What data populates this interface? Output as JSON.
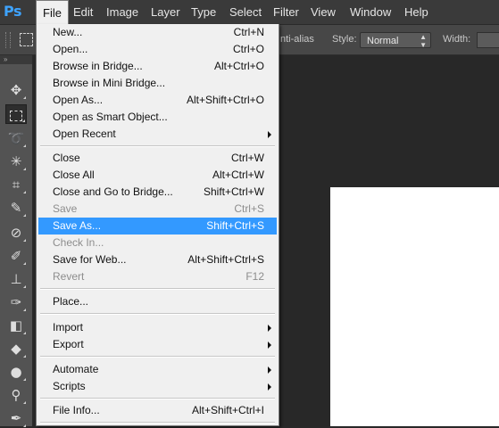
{
  "app": {
    "logo": "Ps"
  },
  "menubar": {
    "items": [
      "File",
      "Edit",
      "Image",
      "Layer",
      "Type",
      "Select",
      "Filter",
      "View",
      "Window",
      "Help"
    ],
    "active": "File"
  },
  "options": {
    "antialias_label": "nti-alias",
    "style_label": "Style:",
    "style_value": "Normal",
    "width_label": "Width:"
  },
  "tools": [
    "move-tool-icon",
    "rectangular-marquee-tool-icon",
    "lasso-tool-icon",
    "magic-wand-tool-icon",
    "crop-tool-icon",
    "eyedropper-tool-icon",
    "spot-healing-brush-tool-icon",
    "brush-tool-icon",
    "clone-stamp-tool-icon",
    "history-brush-tool-icon",
    "eraser-tool-icon",
    "paint-bucket-tool-icon",
    "blur-tool-icon",
    "dodge-tool-icon",
    "pen-tool-icon"
  ],
  "file_menu": {
    "groups": [
      [
        {
          "label": "New...",
          "shortcut": "Ctrl+N"
        },
        {
          "label": "Open...",
          "shortcut": "Ctrl+O"
        },
        {
          "label": "Browse in Bridge...",
          "shortcut": "Alt+Ctrl+O"
        },
        {
          "label": "Browse in Mini Bridge...",
          "shortcut": ""
        },
        {
          "label": "Open As...",
          "shortcut": "Alt+Shift+Ctrl+O"
        },
        {
          "label": "Open as Smart Object...",
          "shortcut": ""
        },
        {
          "label": "Open Recent",
          "shortcut": "",
          "submenu": true
        }
      ],
      [
        {
          "label": "Close",
          "shortcut": "Ctrl+W"
        },
        {
          "label": "Close All",
          "shortcut": "Alt+Ctrl+W"
        },
        {
          "label": "Close and Go to Bridge...",
          "shortcut": "Shift+Ctrl+W"
        },
        {
          "label": "Save",
          "shortcut": "Ctrl+S",
          "disabled": true
        },
        {
          "label": "Save As...",
          "shortcut": "Shift+Ctrl+S",
          "highlighted": true
        },
        {
          "label": "Check In...",
          "shortcut": "",
          "disabled": true
        },
        {
          "label": "Save for Web...",
          "shortcut": "Alt+Shift+Ctrl+S"
        },
        {
          "label": "Revert",
          "shortcut": "F12",
          "disabled": true
        }
      ],
      [
        {
          "label": "Place...",
          "shortcut": ""
        }
      ],
      [
        {
          "label": "Import",
          "shortcut": "",
          "submenu": true
        },
        {
          "label": "Export",
          "shortcut": "",
          "submenu": true
        }
      ],
      [
        {
          "label": "Automate",
          "shortcut": "",
          "submenu": true
        },
        {
          "label": "Scripts",
          "shortcut": "",
          "submenu": true
        }
      ],
      [
        {
          "label": "File Info...",
          "shortcut": "Alt+Shift+Ctrl+I"
        }
      ]
    ]
  },
  "colors": {
    "highlight": "#3399ff",
    "menu_bg": "#f0f0f0",
    "app_bg": "#282828",
    "logo": "#3ea3ff"
  }
}
